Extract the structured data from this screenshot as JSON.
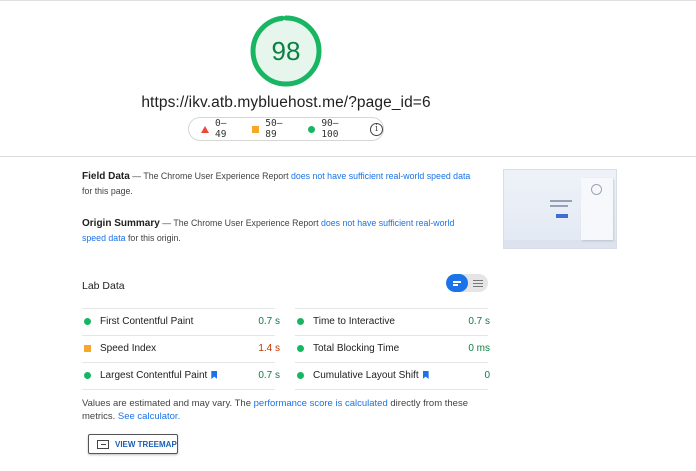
{
  "score": {
    "value": "98",
    "fraction": 0.98,
    "color": "#18b663"
  },
  "url": "https://ikv.atb.mybluehost.me/?page_id=6",
  "legend": {
    "poor": "0–49",
    "average": "50–89",
    "good": "90–100"
  },
  "field_data": {
    "title": "Field Data",
    "dash": " — ",
    "text_before": "The Chrome User Experience Report ",
    "link": "does not have sufficient real-world speed data",
    "text_after": " for this page."
  },
  "origin_summary": {
    "title": "Origin Summary",
    "dash": " — ",
    "text_before": "The Chrome User Experience Report ",
    "link": "does not have sufficient real-world speed data",
    "text_after": " for this origin."
  },
  "lab_data": {
    "title": "Lab Data",
    "metrics": [
      {
        "label": "First Contentful Paint",
        "value": "0.7 s",
        "status": "good"
      },
      {
        "label": "Time to Interactive",
        "value": "0.7 s",
        "status": "good"
      },
      {
        "label": "Speed Index",
        "value": "1.4 s",
        "status": "average"
      },
      {
        "label": "Total Blocking Time",
        "value": "0 ms",
        "status": "good"
      },
      {
        "label": "Largest Contentful Paint",
        "value": "0.7 s",
        "status": "good"
      },
      {
        "label": "Cumulative Layout Shift",
        "value": "0",
        "status": "good"
      }
    ]
  },
  "note": {
    "text_before": "Values are estimated and may vary. The ",
    "link1": "performance score is calculated",
    "text_mid": " directly from these metrics. ",
    "link2": "See calculator."
  },
  "treemap_button": "VIEW TREEMAP",
  "colors": {
    "good": "#18b663",
    "average": "#f6a82a",
    "poor": "#eb4a3b",
    "link": "#1a73e8"
  }
}
